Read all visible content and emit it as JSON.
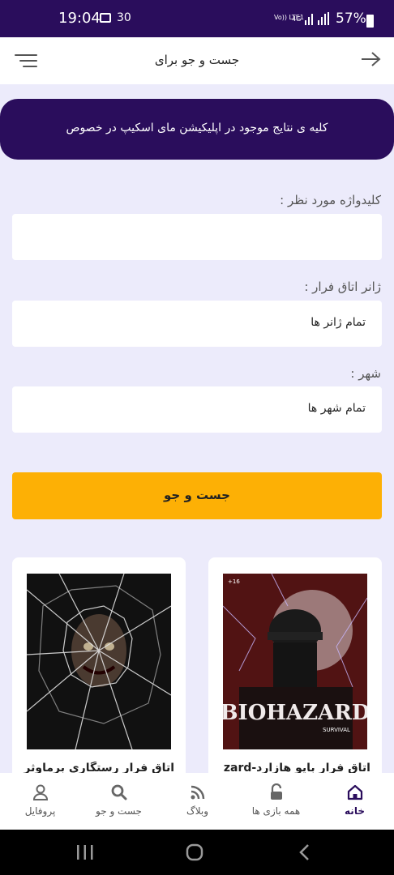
{
  "status_bar": {
    "time": "19:04",
    "notification_count": "30",
    "volte": "Vo)) LTE1",
    "network": "4G",
    "battery": "57%"
  },
  "header": {
    "title": "جست و جو برای"
  },
  "banner": {
    "text": "کلیه ی نتایج موجود در اپلیکیشن مای اسکیپ در خصوص"
  },
  "form": {
    "keyword": {
      "label": "کلیدواژه مورد نظر :",
      "value": ""
    },
    "genre": {
      "label": "ژانر اتاق فرار :",
      "value": "تمام ژانر ها"
    },
    "city": {
      "label": "شهر :",
      "value": "تمام شهر ها"
    },
    "submit_label": "جست و جو"
  },
  "results": [
    {
      "title": "اتاق فرار بایو هازارد-zard",
      "poster_text": "BIOHAZARD",
      "poster_subtext": "SURVIVAL",
      "age_badge": "+16"
    },
    {
      "title": "اتاق فرار رستگاری برماوثر"
    }
  ],
  "bottom_nav": {
    "items": [
      {
        "label": "خانه",
        "icon": "home-icon",
        "active": true
      },
      {
        "label": "همه بازی ها",
        "icon": "unlock-icon"
      },
      {
        "label": "وبلاگ",
        "icon": "rss-icon"
      },
      {
        "label": "جست و جو",
        "icon": "search-icon"
      },
      {
        "label": "پروفایل",
        "icon": "user-icon"
      }
    ]
  },
  "colors": {
    "primary": "#2a0d5c",
    "accent": "#fdb005",
    "background": "#ecebfb"
  }
}
